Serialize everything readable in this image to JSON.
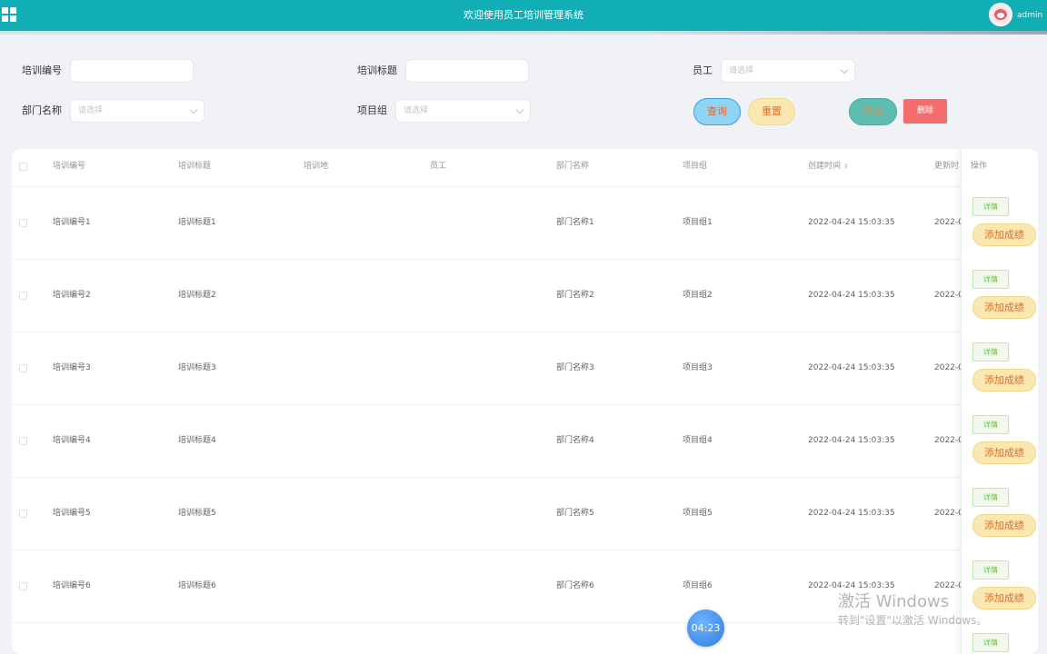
{
  "header": {
    "title": "欢迎使用员工培训管理系统",
    "user": "admin",
    "menu_icon": "grid-icon",
    "avatar": "avatar"
  },
  "search": {
    "fields": {
      "train_no": {
        "label": "培训编号",
        "value": ""
      },
      "train_title": {
        "label": "培训标题",
        "value": ""
      },
      "employee": {
        "label": "员工",
        "placeholder": "请选择"
      },
      "dept": {
        "label": "部门名称",
        "placeholder": "请选择"
      },
      "project_group": {
        "label": "项目组",
        "placeholder": "请选择"
      }
    },
    "buttons": {
      "query": "查询",
      "reset": "重置",
      "add": "添加",
      "delete": "删除"
    }
  },
  "table": {
    "columns": [
      "培训编号",
      "培训标题",
      "培训地",
      "员工",
      "部门名称",
      "项目组",
      "创建时间",
      "更新时"
    ],
    "sort_icon": "⇕",
    "op_header": "操作",
    "op_detail": "详情",
    "op_score": "添加成绩",
    "rows": [
      {
        "train_no": "培训编号1",
        "title": "培训标题1",
        "place": "",
        "employee": "",
        "dept": "部门名称1",
        "group": "项目组1",
        "created": "2022-04-24 15:03:35",
        "updated": "2022-0"
      },
      {
        "train_no": "培训编号2",
        "title": "培训标题2",
        "place": "",
        "employee": "",
        "dept": "部门名称2",
        "group": "项目组2",
        "created": "2022-04-24 15:03:35",
        "updated": "2022-0"
      },
      {
        "train_no": "培训编号3",
        "title": "培训标题3",
        "place": "",
        "employee": "",
        "dept": "部门名称3",
        "group": "项目组3",
        "created": "2022-04-24 15:03:35",
        "updated": "2022-0"
      },
      {
        "train_no": "培训编号4",
        "title": "培训标题4",
        "place": "",
        "employee": "",
        "dept": "部门名称4",
        "group": "项目组4",
        "created": "2022-04-24 15:03:35",
        "updated": "2022-0"
      },
      {
        "train_no": "培训编号5",
        "title": "培训标题5",
        "place": "",
        "employee": "",
        "dept": "部门名称5",
        "group": "项目组5",
        "created": "2022-04-24 15:03:35",
        "updated": "2022-0"
      },
      {
        "train_no": "培训编号6",
        "title": "培训标题6",
        "place": "",
        "employee": "",
        "dept": "部门名称6",
        "group": "项目组6",
        "created": "2022-04-24 15:03:35",
        "updated": "2022-0"
      }
    ]
  },
  "overlay": {
    "timer": "04:23",
    "watermark_line1": "激活 Windows",
    "watermark_line2": "转到\"设置\"以激活 Windows。"
  },
  "colors": {
    "header_bg": "#12aeb5",
    "danger": "#f56c6c",
    "score_btn": "#fbe7b0"
  }
}
